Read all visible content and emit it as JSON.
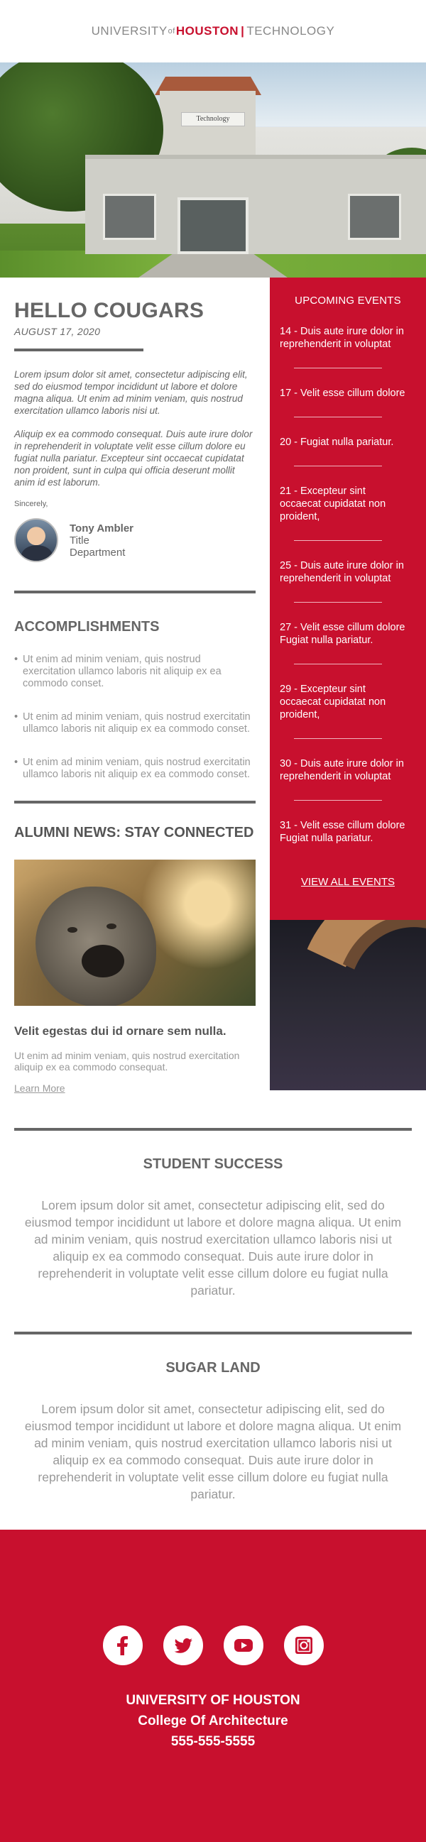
{
  "brand": {
    "university": "UNIVERSITY",
    "of": "of",
    "houston": "HOUSTON",
    "separator": "|",
    "technology": "TECHNOLOGY"
  },
  "hero": {
    "building_sign": "Technology"
  },
  "intro": {
    "title": "HELLO COUGARS",
    "date": "AUGUST 17, 2020",
    "paragraphs": [
      "Lorem ipsum dolor sit amet, consectetur adipiscing elit, sed do eiusmod tempor incididunt ut labore et dolore magna aliqua. Ut enim ad minim veniam, quis nostrud exercitation ullamco laboris nisi ut.",
      "Aliquip ex ea commodo consequat. Duis aute irure dolor in reprehenderit in voluptate velit esse cillum dolore eu fugiat nulla pariatur. Excepteur sint occaecat cupidatat non proident, sunt in culpa qui officia deserunt mollit anim id est laborum."
    ],
    "sincerely": "Sincerely,",
    "signer": {
      "name": "Tony Ambler",
      "title": "Title",
      "department": "Department"
    }
  },
  "accomplishments": {
    "heading": "ACCOMPLISHMENTS",
    "items": [
      "Ut enim ad minim veniam, quis nostrud exercitation ullamco laboris nit aliquip ex ea commodo conset.",
      "Ut enim ad minim veniam, quis nostrud exercitatin ullamco laboris nit aliquip ex ea commodo conset.",
      "Ut enim ad minim veniam, quis nostrud exercitatin ullamco laboris nit aliquip ex ea commodo conset."
    ]
  },
  "alumni": {
    "heading": "ALUMNI NEWS: STAY CONNECTED",
    "story_title": "Velit egestas dui id ornare sem nulla.",
    "story_text": "Ut enim ad minim veniam, quis nostrud exercitation aliquip ex ea commodo consequat.",
    "learn_more": "Learn More"
  },
  "events": {
    "heading": "UPCOMING EVENTS",
    "items": [
      "14 - Duis aute irure dolor in reprehenderit in voluptat",
      "17 - Velit esse cillum dolore",
      "20 - Fugiat nulla pariatur.",
      "21 - Excepteur sint occaecat cupidatat non proident,",
      "25 - Duis aute irure dolor in reprehenderit in voluptat",
      "27 - Velit esse cillum dolore Fugiat nulla pariatur.",
      "29 - Excepteur sint occaecat cupidatat non proident,",
      "30 - Duis aute irure dolor in reprehenderit in voluptat",
      "31 - Velit esse cillum dolore Fugiat nulla pariatur."
    ],
    "view_all": "VIEW ALL EVENTS"
  },
  "student_success": {
    "heading": "STUDENT SUCCESS",
    "text": "Lorem ipsum dolor sit amet, consectetur adipiscing elit, sed do eiusmod tempor incididunt ut labore et dolore magna aliqua. Ut enim ad minim veniam, quis nostrud exercitation ullamco laboris nisi ut aliquip ex ea commodo consequat. Duis aute irure dolor in reprehenderit in voluptate velit esse cillum dolore eu fugiat nulla pariatur."
  },
  "sugar_land": {
    "heading": "SUGAR LAND",
    "text": "Lorem ipsum dolor sit amet, consectetur adipiscing elit, sed do eiusmod tempor incididunt ut labore et dolore magna aliqua. Ut enim ad minim veniam, quis nostrud exercitation ullamco laboris nisi ut aliquip ex ea commodo consequat. Duis aute irure dolor in reprehenderit in voluptate velit esse cillum dolore eu fugiat nulla pariatur."
  },
  "footer": {
    "socials": [
      "facebook-icon",
      "twitter-icon",
      "youtube-icon",
      "instagram-icon"
    ],
    "line1": "UNIVERSITY OF HOUSTON",
    "line2": "College Of Architecture",
    "phone": "555-555-5555"
  },
  "colors": {
    "brand_red": "#c8102e",
    "text_gray": "#666666",
    "light_gray": "#999999"
  }
}
